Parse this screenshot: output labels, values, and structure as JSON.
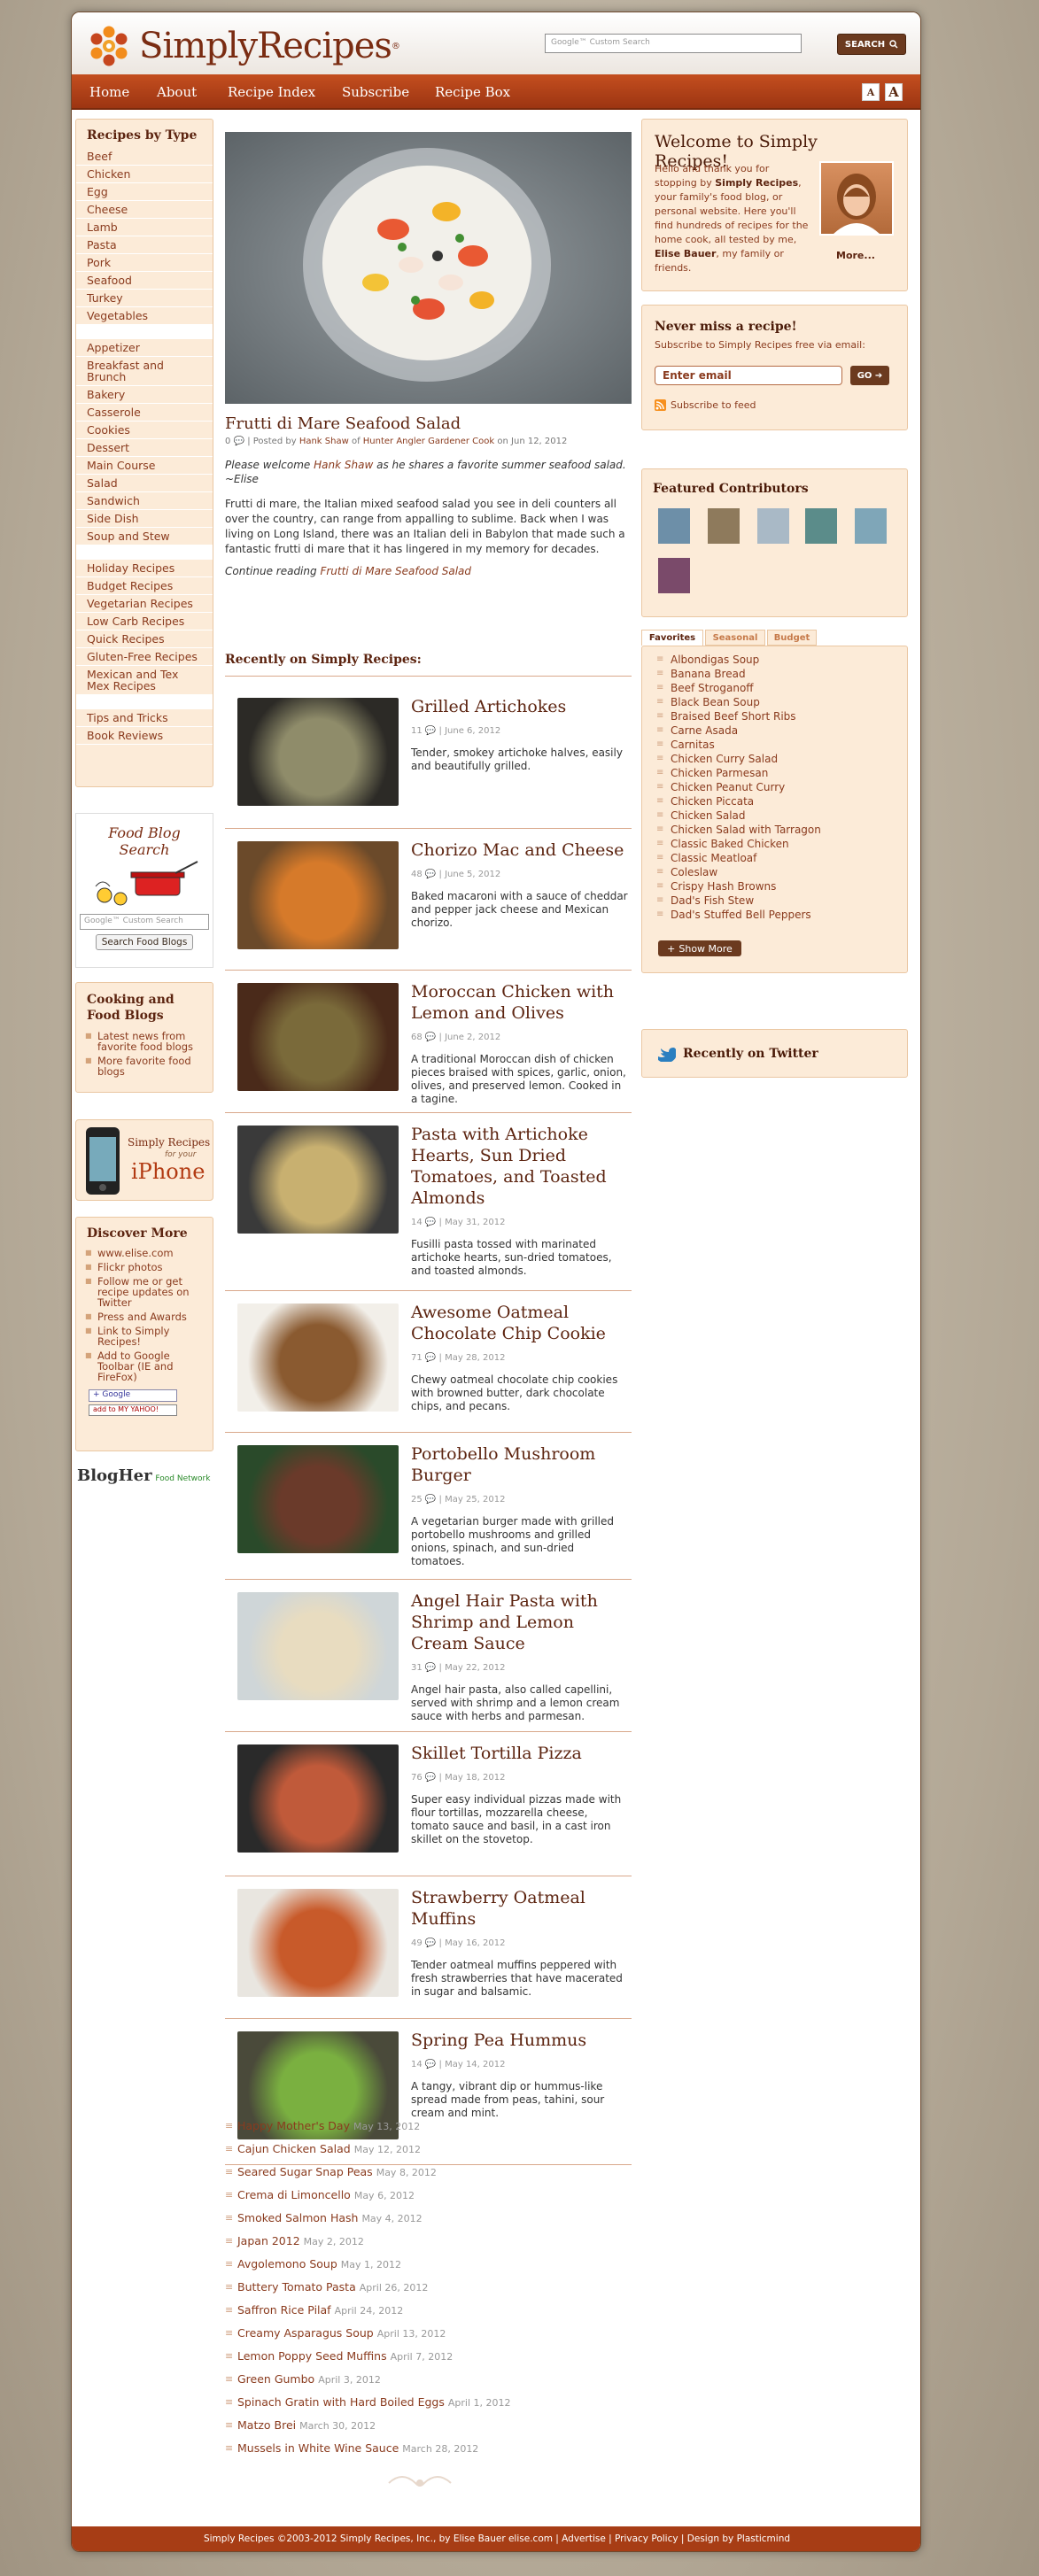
{
  "header": {
    "brand": "SimplyRecipes",
    "search_placeholder": "Google™ Custom Search",
    "search_button": "SEARCH"
  },
  "nav": {
    "items": [
      "Home",
      "About",
      "Recipe Index",
      "Subscribe",
      "Recipe Box"
    ],
    "font_small": "A",
    "font_large": "A"
  },
  "left": {
    "recipes_title": "Recipes by Type",
    "group1": [
      "Beef",
      "Chicken",
      "Egg",
      "Cheese",
      "Lamb",
      "Pasta",
      "Pork",
      "Seafood",
      "Turkey",
      "Vegetables"
    ],
    "group2": [
      "Appetizer",
      "Breakfast and Brunch",
      "Bakery",
      "Casserole",
      "Cookies",
      "Dessert",
      "Main Course",
      "Salad",
      "Sandwich",
      "Side Dish",
      "Soup and Stew"
    ],
    "group3": [
      "Holiday Recipes",
      "Budget Recipes",
      "Vegetarian Recipes",
      "Low Carb Recipes",
      "Quick Recipes",
      "Gluten-Free Recipes",
      "Mexican and Tex Mex Recipes"
    ],
    "group4": [
      "Tips and Tricks",
      "Book Reviews"
    ],
    "foodblog_line1": "Food Blog",
    "foodblog_line2": "Search",
    "foodblog_placeholder": "Google™ Custom Search",
    "foodblog_button": "Search Food Blogs",
    "cooking_title": "Cooking and Food Blogs",
    "cooking_items": [
      "Latest news from favorite food blogs",
      "More favorite food blogs"
    ],
    "iphone_line1": "Simply Recipes",
    "iphone_line2": "for your",
    "iphone_line3": "iPhone",
    "discover_title": "Discover More",
    "discover_items": [
      "www.elise.com",
      "Flickr photos",
      "Follow me or get recipe updates on Twitter",
      "Press and Awards",
      "Link to Simply Recipes!",
      "Add to Google Toolbar (IE and FireFox)"
    ],
    "add_google": "+ Google",
    "add_yahoo": "add to MY YAHOO!",
    "blogher": "BlogHer",
    "blogher_sub": "Food Network"
  },
  "featured": {
    "title": "Frutti di Mare Seafood Salad",
    "comments": "0",
    "posted_by": "Posted by",
    "author": "Hank Shaw",
    "of": "of",
    "site": "Hunter Angler Gardener Cook",
    "date": "on Jun 12, 2012",
    "intro_pre": "Please welcome",
    "intro_name": "Hank Shaw",
    "intro_post": "as he shares a favorite summer seafood salad. ~Elise",
    "body": "Frutti di mare, the Italian mixed seafood salad you see in deli counters all over the country, can range from appalling to sublime. Back when I was living on Long Island, there was an Italian deli in Babylon that made such a fantastic frutti di mare that it has lingered in my memory for decades.",
    "continue": "Continue reading",
    "continue_link": "Frutti di Mare Seafood Salad"
  },
  "recent_title": "Recently on Simply Recipes:",
  "recent": [
    {
      "title": "Grilled Artichokes",
      "count": "11",
      "date": "June 6, 2012",
      "desc": "Tender, smokey artichoke halves, easily and beautifully grilled."
    },
    {
      "title": "Chorizo Mac and Cheese",
      "count": "48",
      "date": "June 5, 2012",
      "desc": "Baked macaroni with a sauce of cheddar and pepper jack cheese and Mexican chorizo."
    },
    {
      "title": "Moroccan Chicken with Lemon and Olives",
      "count": "68",
      "date": "June 2, 2012",
      "desc": "A traditional Moroccan dish of chicken pieces braised with spices, garlic, onion, olives, and preserved lemon. Cooked in a tagine."
    },
    {
      "title": "Pasta with Artichoke Hearts, Sun Dried Tomatoes, and Toasted Almonds",
      "count": "14",
      "date": "May 31, 2012",
      "desc": "Fusilli pasta tossed with marinated artichoke hearts, sun-dried tomatoes, and toasted almonds."
    },
    {
      "title": "Awesome Oatmeal Chocolate Chip Cookie",
      "count": "71",
      "date": "May 28, 2012",
      "desc": "Chewy oatmeal chocolate chip cookies with browned butter, dark chocolate chips, and pecans."
    },
    {
      "title": "Portobello Mushroom Burger",
      "count": "25",
      "date": "May 25, 2012",
      "desc": "A vegetarian burger made with grilled portobello mushrooms and grilled onions, spinach, and sun-dried tomatoes."
    },
    {
      "title": "Angel Hair Pasta with Shrimp and Lemon Cream Sauce",
      "count": "31",
      "date": "May 22, 2012",
      "desc": "Angel hair pasta, also called capellini, served with shrimp and a lemon cream sauce with herbs and parmesan."
    },
    {
      "title": "Skillet Tortilla Pizza",
      "count": "76",
      "date": "May 18, 2012",
      "desc": "Super easy individual pizzas made with flour tortillas, mozzarella cheese, tomato sauce and basil, in a cast iron skillet on the stovetop."
    },
    {
      "title": "Strawberry Oatmeal Muffins",
      "count": "49",
      "date": "May 16, 2012",
      "desc": "Tender oatmeal muffins peppered with fresh strawberries that have macerated in sugar and balsamic."
    },
    {
      "title": "Spring Pea Hummus",
      "count": "14",
      "date": "May 14, 2012",
      "desc": "A tangy, vibrant dip or hummus-like spread made from peas, tahini, sour cream and mint."
    }
  ],
  "older": [
    {
      "t": "Happy Mother's Day",
      "d": "May 13, 2012"
    },
    {
      "t": "Cajun Chicken Salad",
      "d": "May 12, 2012"
    },
    {
      "t": "Seared Sugar Snap Peas",
      "d": "May 8, 2012"
    },
    {
      "t": "Crema di Limoncello",
      "d": "May 6, 2012"
    },
    {
      "t": "Smoked Salmon Hash",
      "d": "May 4, 2012"
    },
    {
      "t": "Japan 2012",
      "d": "May 2, 2012"
    },
    {
      "t": "Avgolemono Soup",
      "d": "May 1, 2012"
    },
    {
      "t": "Buttery Tomato Pasta",
      "d": "April 26, 2012"
    },
    {
      "t": "Saffron Rice Pilaf",
      "d": "April 24, 2012"
    },
    {
      "t": "Creamy Asparagus Soup",
      "d": "April 13, 2012"
    },
    {
      "t": "Lemon Poppy Seed Muffins",
      "d": "April 7, 2012"
    },
    {
      "t": "Green Gumbo",
      "d": "April 3, 2012"
    },
    {
      "t": "Spinach Gratin with Hard Boiled Eggs",
      "d": "April 1, 2012"
    },
    {
      "t": "Matzo Brei",
      "d": "March 30, 2012"
    },
    {
      "t": "Mussels in White Wine Sauce",
      "d": "March 28, 2012"
    }
  ],
  "right": {
    "welcome_title": "Welcome to Simply Recipes!",
    "welcome_p1": "Hello and thank you for stopping by",
    "welcome_brand": "Simply Recipes",
    "welcome_p2": ", your family's food blog, or personal website. Here you'll find hundreds of recipes for the home cook, all tested by me,",
    "welcome_name": "Elise Bauer",
    "welcome_p3": ", my family or friends.",
    "welcome_more": "More...",
    "never_title": "Never miss a recipe!",
    "never_text": "Subscribe to Simply Recipes free via email:",
    "email_placeholder": "Enter email",
    "go": "GO",
    "feed": "Subscribe to feed",
    "contrib_title": "Featured Contributors",
    "tabs": [
      "Favorites",
      "Seasonal",
      "Budget"
    ],
    "favorites": [
      "Albondigas Soup",
      "Banana Bread",
      "Beef Stroganoff",
      "Black Bean Soup",
      "Braised Beef Short Ribs",
      "Carne Asada",
      "Carnitas",
      "Chicken Curry Salad",
      "Chicken Parmesan",
      "Chicken Peanut Curry",
      "Chicken Piccata",
      "Chicken Salad",
      "Chicken Salad with Tarragon",
      "Classic Baked Chicken",
      "Classic Meatloaf",
      "Coleslaw",
      "Crispy Hash Browns",
      "Dad's Fish Stew",
      "Dad's Stuffed Bell Peppers"
    ],
    "show_more": "Show More",
    "twitter_title": "Recently on Twitter"
  },
  "footer": "Simply Recipes ©2003-2012 Simply Recipes, Inc., by Elise Bauer elise.com | Advertise | Privacy Policy | Design by Plasticmind"
}
